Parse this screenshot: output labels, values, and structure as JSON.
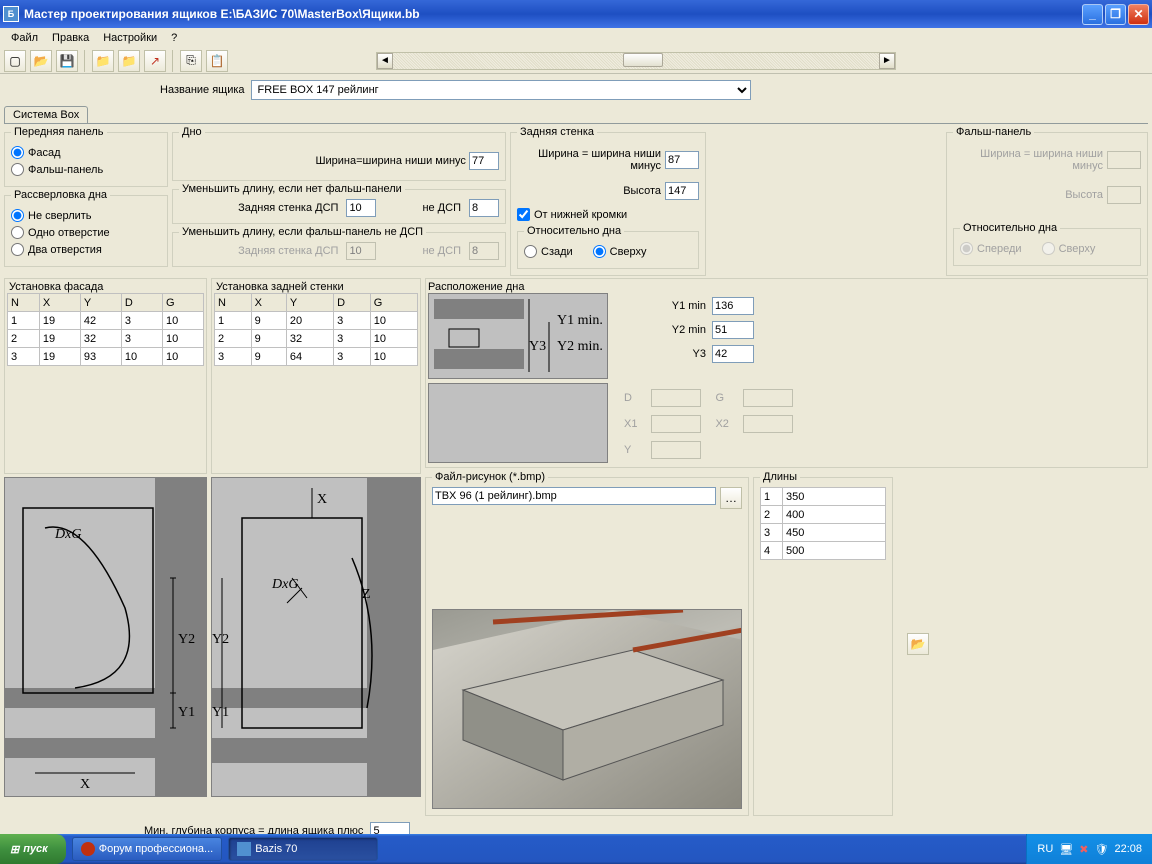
{
  "window": {
    "title": "Мастер проектирования ящиков  E:\\БАЗИС 70\\MasterBox\\Ящики.bb"
  },
  "menu": [
    "Файл",
    "Правка",
    "Настройки",
    "?"
  ],
  "name_label": "Название ящика",
  "name_value": "FREE  BOX 147 рейлинг",
  "tab": "Система Box",
  "front_panel": {
    "legend": "Передняя панель",
    "options": [
      "Фасад",
      "Фальш-панель"
    ]
  },
  "drill": {
    "legend": "Рассверловка дна",
    "options": [
      "Не сверлить",
      "Одно отверстие",
      "Два отверстия"
    ]
  },
  "bottom": {
    "legend": "Дно",
    "width_label": "Ширина=ширина ниши минус",
    "width_val": "77",
    "reduce_nofalse": "Уменьшить длину, если нет фальш-панели",
    "back_dsp": "Задняя стенка ДСП",
    "back_dsp_val": "10",
    "not_dsp": "не ДСП",
    "not_dsp_val": "8",
    "reduce_false_notdsp": "Уменьшить длину, если фальш-панель не ДСП",
    "back_dsp_val2": "10",
    "not_dsp_val2": "8"
  },
  "back_wall": {
    "legend": "Задняя стенка",
    "width_label": "Ширина = ширина ниши минус",
    "width_val": "87",
    "height_label": "Высота",
    "height_val": "147",
    "from_edge": "От нижней кромки",
    "relative": "Относительно дна",
    "rel_opts": [
      "Сзади",
      "Сверху"
    ]
  },
  "false_panel": {
    "legend": "Фальш-панель",
    "width_label": "Ширина = ширина ниши минус",
    "height_label": "Высота",
    "relative": "Относительно дна",
    "rel_opts": [
      "Спереди",
      "Сверху"
    ]
  },
  "install_facade": {
    "legend": "Установка фасада",
    "headers": [
      "N",
      "X",
      "Y",
      "D",
      "G"
    ],
    "rows": [
      [
        "1",
        "19",
        "42",
        "3",
        "10"
      ],
      [
        "2",
        "19",
        "32",
        "3",
        "10"
      ],
      [
        "3",
        "19",
        "93",
        "10",
        "10"
      ]
    ]
  },
  "install_back": {
    "legend": "Установка задней стенки",
    "headers": [
      "N",
      "X",
      "Y",
      "D",
      "G"
    ],
    "rows": [
      [
        "1",
        "9",
        "20",
        "3",
        "10"
      ],
      [
        "2",
        "9",
        "32",
        "3",
        "10"
      ],
      [
        "3",
        "9",
        "64",
        "3",
        "10"
      ]
    ]
  },
  "raspol": {
    "legend": "Расположение дна",
    "y1min_label": "Y1 min",
    "y1min": "136",
    "y2min_label": "Y2 min",
    "y2min": "51",
    "y3_label": "Y3",
    "y3": "42",
    "d": "D",
    "g": "G",
    "x1": "X1",
    "x2": "X2",
    "y": "Y"
  },
  "file_pic": {
    "legend": "Файл-рисунок (*.bmp)",
    "value": "TBX 96 (1 рейлинг).bmp"
  },
  "lengths": {
    "legend": "Длины",
    "rows": [
      [
        "1",
        "350"
      ],
      [
        "2",
        "400"
      ],
      [
        "3",
        "450"
      ],
      [
        "4",
        "500"
      ]
    ]
  },
  "min_depth": {
    "label": "Мин. глубина корпуса = длина ящика плюс",
    "value": "5"
  },
  "taskbar": {
    "start": "пуск",
    "items": [
      "Форум профессиона...",
      "Bazis 70"
    ],
    "lang": "RU",
    "time": "22:08"
  }
}
